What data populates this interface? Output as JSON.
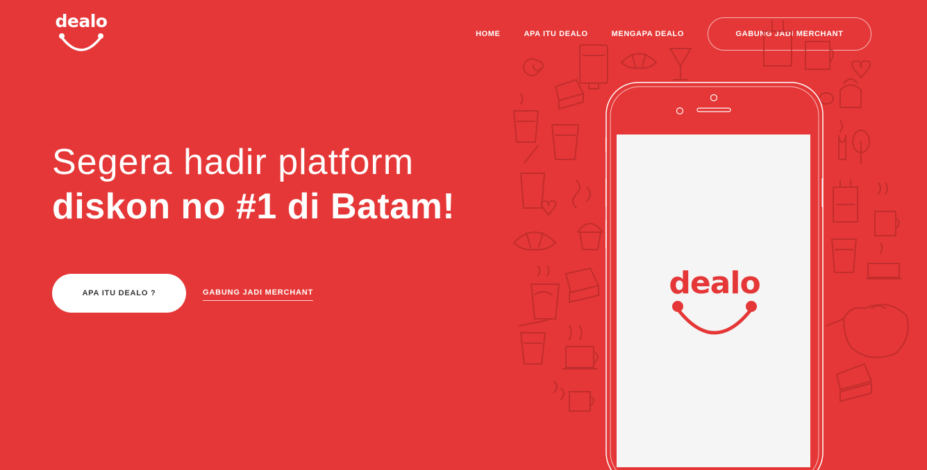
{
  "brand": {
    "name": "dealo",
    "color": "#e53737"
  },
  "nav": {
    "items": [
      "HOME",
      "APA ITU DEALO",
      "MENGAPA DEALO"
    ],
    "cta_label": "GABUNG JADI MERCHANT"
  },
  "hero": {
    "line1": "Segera hadir platform",
    "line2": "diskon no #1 di Batam!",
    "primary_button": "APA ITU DEALO ?",
    "secondary_link": "GABUNG JADI MERCHANT"
  },
  "phone": {
    "screen_logo": "dealo"
  },
  "icons": [
    "smile-icon",
    "coffee-doodle-icon"
  ]
}
